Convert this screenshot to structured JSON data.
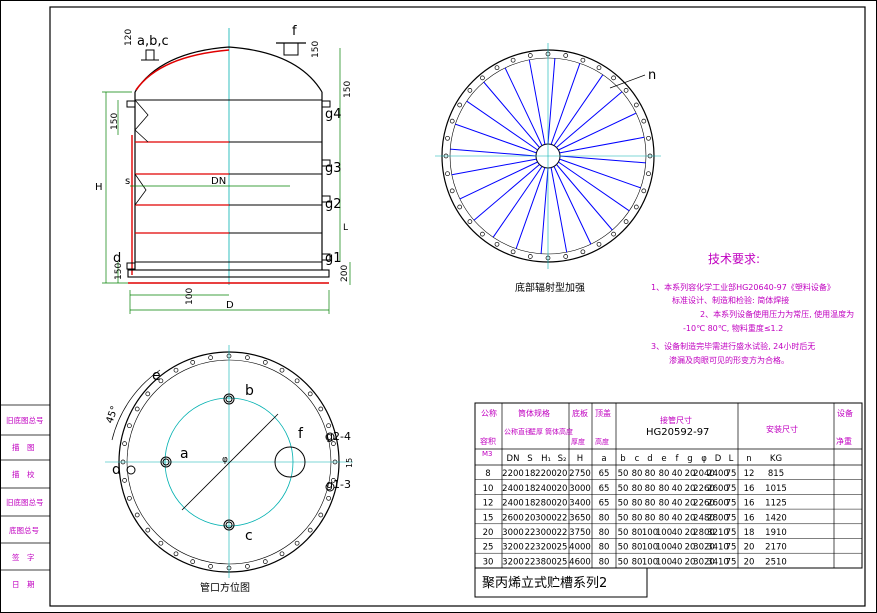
{
  "colors": {
    "outline": "#000000",
    "center_line": "#00b0b0",
    "rib": "#0000ff",
    "shell_red": "#e00000",
    "note": "#c000c0",
    "dims": "#008000"
  },
  "elevation": {
    "labels": {
      "abc": "a,b,c",
      "f": "f",
      "dn": "DN",
      "s": "s",
      "h": "H",
      "d": "d",
      "D": "D",
      "g1": "g1",
      "g2": "g2",
      "g3": "g3",
      "g4": "g4",
      "l": "L"
    },
    "dims": {
      "d120": "120",
      "d150_top": "150",
      "d150_left": "150",
      "d150_right": "150",
      "d200": "200",
      "d100": "100",
      "d150_bot": "150"
    }
  },
  "bottom_view": {
    "caption": "底部辐射型加强",
    "label_n": "n",
    "rib_count": 24
  },
  "plan_view": {
    "caption": "管口方位图",
    "labels": {
      "a": "a",
      "b": "b",
      "c": "c",
      "d": "d",
      "e": "e",
      "f": "f",
      "g24": "g2-4",
      "g13": "g1-3",
      "angle": "45°",
      "phi": "φ",
      "d15": "15"
    }
  },
  "notes": {
    "title": "技术要求:",
    "lines": [
      "1、本系列容化学工业部HG20640-97《塑料设备》",
      "标准设计、制造和检验: 简体焊接",
      "2、本系列设备使用压力为常压, 使用温度为",
      "-10℃  80℃, 物料重度≤1.2",
      "3、设备制造完毕需进行盛水试验, 24小时后无",
      "渗漏及肉眼可见的形变方为合格。"
    ]
  },
  "left_column": [
    "旧底图总号",
    "描　图",
    "描　校",
    "旧底图总号",
    "底图总号",
    "签　字",
    "日　期"
  ],
  "table": {
    "head1": {
      "vol": "公称",
      "shell": "筒体规格",
      "bottom": "底板",
      "cover": "顶盖",
      "nozzle": "接管尺寸",
      "install": "安装尺寸",
      "weight": "设备"
    },
    "head2": {
      "vol": "容积",
      "volunit": "M3",
      "dn": "公称直径",
      "s": "壁厚",
      "h1": "筒体高度",
      "s2": "厚度",
      "h": "高度",
      "std": "HG20592-97",
      "weight": "净重"
    },
    "cols": [
      "DN",
      "S",
      "H₁",
      "S₂",
      "H",
      "a",
      "b",
      "c",
      "d",
      "e",
      "f",
      "g",
      "φ",
      "D",
      "L",
      "n",
      "KG"
    ],
    "rows": [
      [
        "8",
        "2200",
        "18",
        "2200",
        "20",
        "2750",
        "65",
        "50",
        "80",
        "80",
        "80",
        "40",
        "20",
        "2040",
        "2400",
        "75",
        "12",
        "815"
      ],
      [
        "10",
        "2400",
        "18",
        "2400",
        "20",
        "3000",
        "65",
        "50",
        "80",
        "80",
        "80",
        "40",
        "20",
        "2260",
        "2600",
        "75",
        "16",
        "1015"
      ],
      [
        "12",
        "2400",
        "18",
        "2800",
        "20",
        "3400",
        "65",
        "50",
        "80",
        "80",
        "80",
        "40",
        "20",
        "2260",
        "2600",
        "75",
        "16",
        "1125"
      ],
      [
        "15",
        "2600",
        "20",
        "3000",
        "22",
        "3650",
        "80",
        "50",
        "80",
        "80",
        "80",
        "40",
        "20",
        "2480",
        "2800",
        "75",
        "16",
        "1420"
      ],
      [
        "20",
        "3000",
        "22",
        "3000",
        "22",
        "3750",
        "80",
        "50",
        "80",
        "100",
        "100",
        "40",
        "20",
        "2800",
        "3210",
        "75",
        "18",
        "1910"
      ],
      [
        "25",
        "3200",
        "22",
        "3200",
        "25",
        "4000",
        "80",
        "50",
        "80",
        "100",
        "100",
        "40",
        "20",
        "3020",
        "3410",
        "75",
        "20",
        "2170"
      ],
      [
        "30",
        "3200",
        "22",
        "3800",
        "25",
        "4600",
        "80",
        "50",
        "80",
        "100",
        "100",
        "40",
        "20",
        "3020",
        "3410",
        "75",
        "20",
        "2510"
      ]
    ],
    "title": "聚丙烯立式贮槽系列2"
  }
}
